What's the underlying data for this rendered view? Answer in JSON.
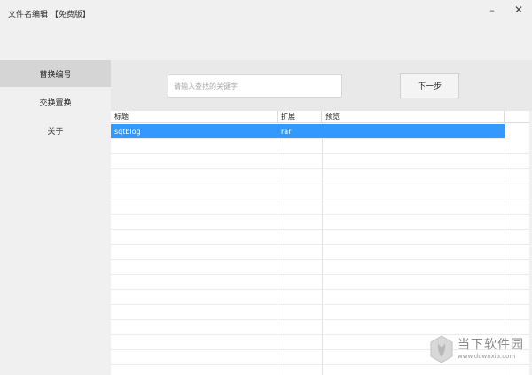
{
  "window": {
    "title": "文件名编辑 【免费版】",
    "minimize_glyph": "–",
    "close_glyph": "✕"
  },
  "sidebar": {
    "items": [
      {
        "label": "替换编号",
        "active": true
      },
      {
        "label": "交换置换",
        "active": false
      },
      {
        "label": "关于",
        "active": false
      }
    ]
  },
  "toolbar": {
    "search_placeholder": "请输入查找的关键字",
    "search_value": "",
    "next_label": "下一步"
  },
  "table": {
    "columns": [
      "标题",
      "扩展",
      "预览"
    ],
    "rows": [
      {
        "title": "sqtblog",
        "ext": "rar",
        "preview": "",
        "selected": true
      }
    ]
  },
  "watermark": {
    "name": "当下软件园",
    "url": "www.downxia.com"
  },
  "colors": {
    "selection": "#3399ff",
    "sidebar_active": "#d5d5d5",
    "background": "#f0f0f0"
  }
}
